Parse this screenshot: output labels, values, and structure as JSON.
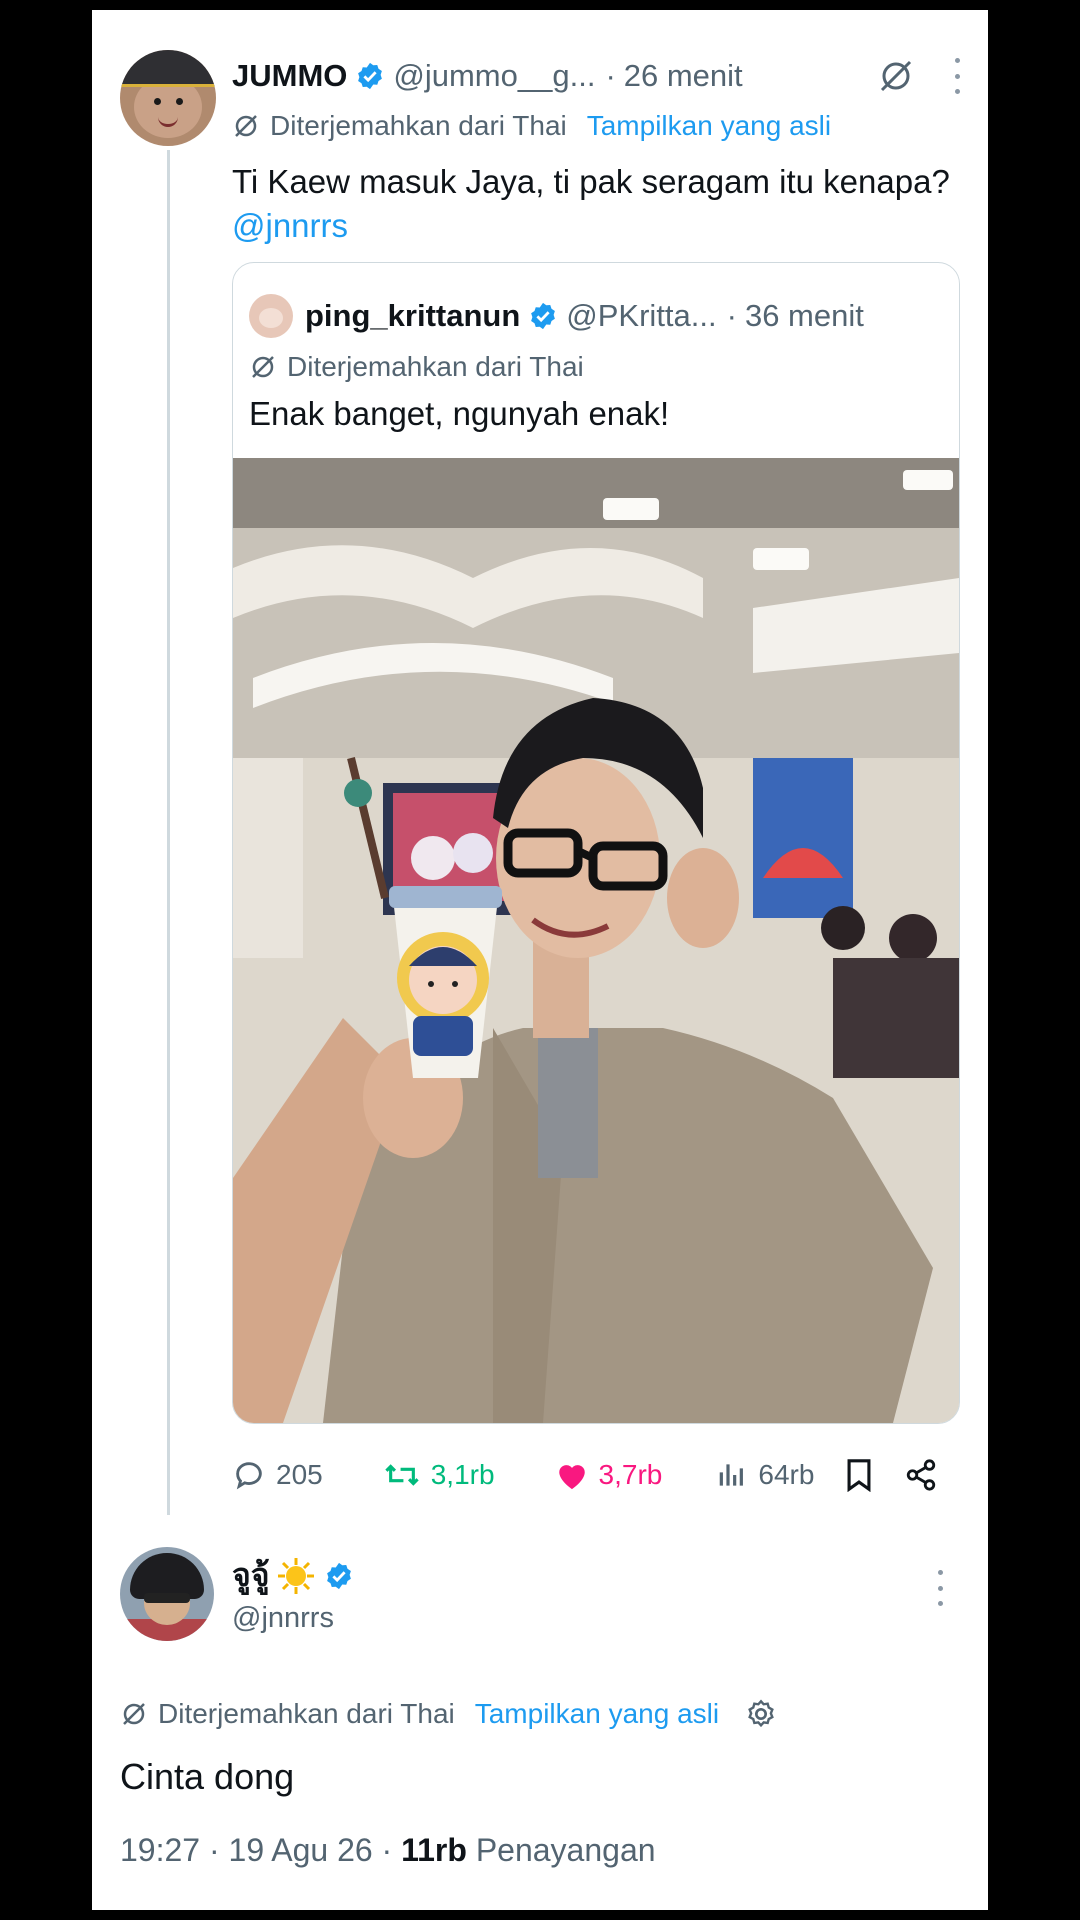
{
  "tweet": {
    "author_name": "JUMMO",
    "handle": "@jummo__g...",
    "dot": "·",
    "time": "26 menit",
    "translated_label": "Diterjemahkan dari Thai",
    "show_original": "Tampilkan yang asli",
    "text": "Ti Kaew masuk Jaya, ti pak seragam itu kenapa?",
    "mention": "@jnnrrs"
  },
  "quote": {
    "author_name": "ping_krittanun",
    "handle": "@PKritta...",
    "dot": "·",
    "time": "36 menit",
    "translated_label": "Diterjemahkan dari Thai",
    "text": "Enak banget, ngunyah enak!"
  },
  "actions": {
    "replies": "205",
    "retweets": "3,1rb",
    "likes": "3,7rb",
    "views": "64rb"
  },
  "reply": {
    "author_name": "จูจู้",
    "handle": "@jnnrrs",
    "translated_label": "Diterjemahkan dari Thai",
    "show_original": "Tampilkan yang asli",
    "text": "Cinta dong",
    "time": "19:27",
    "sep1": "·",
    "date": "19 Agu 26",
    "sep2": "·",
    "views_count": "11rb",
    "views_label": "Penayangan"
  },
  "colors": {
    "link": "#1d9bf0",
    "retweet": "#00ba7c",
    "like": "#f91880",
    "muted": "#536471"
  },
  "icons": [
    "verified-badge-icon",
    "grok-icon",
    "more-icon",
    "translate-icon",
    "reply-icon",
    "retweet-icon",
    "heart-icon",
    "views-icon",
    "bookmark-icon",
    "share-icon",
    "settings-icon",
    "sun-emoji-icon"
  ]
}
